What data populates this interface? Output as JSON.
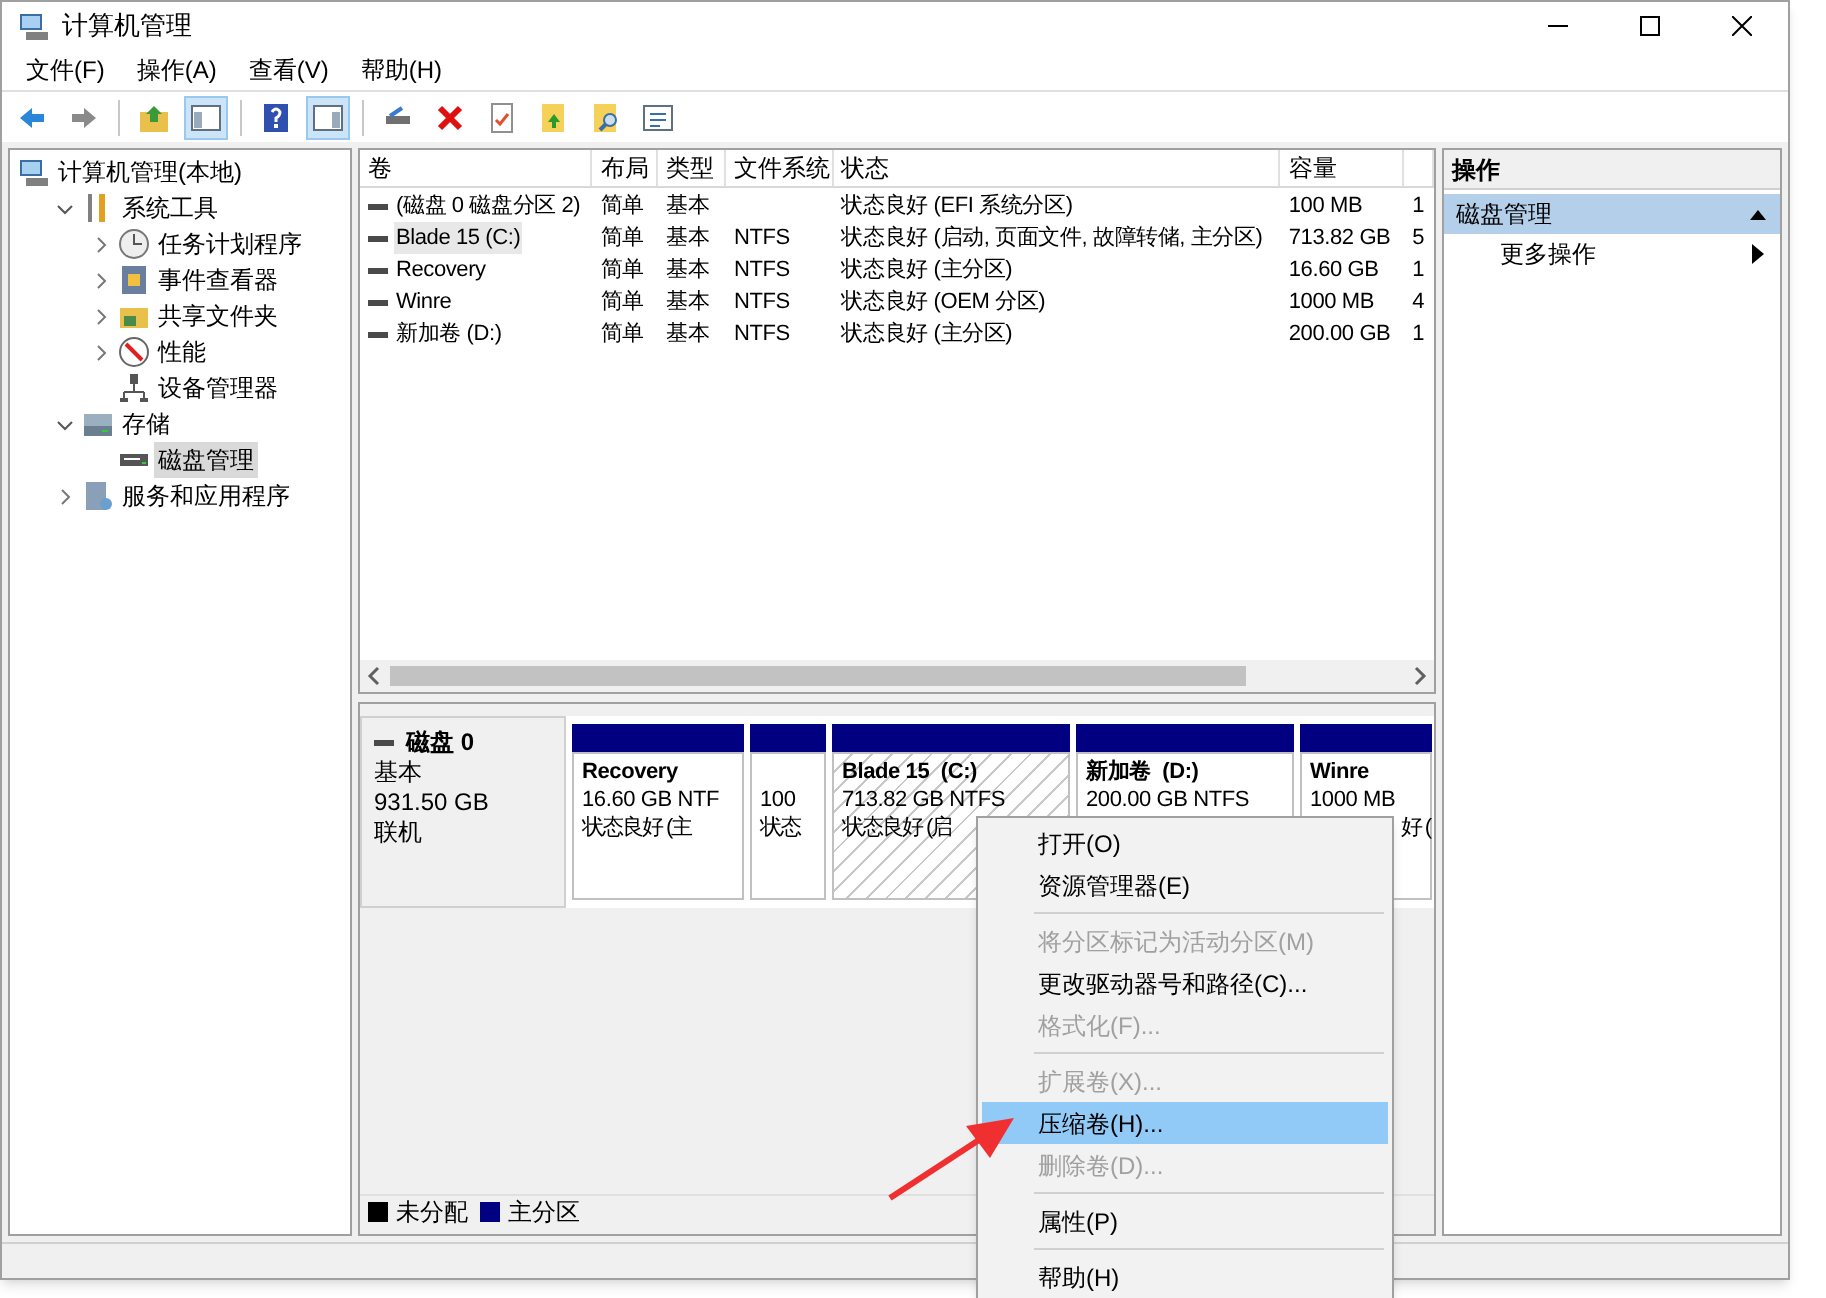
{
  "window": {
    "title": "计算机管理"
  },
  "menu": [
    "文件(F)",
    "操作(A)",
    "查看(V)",
    "帮助(H)"
  ],
  "tree": [
    {
      "label": "计算机管理(本地)",
      "selected": false,
      "children": [
        {
          "label": "系统工具",
          "expanded": true,
          "selected": false,
          "children": [
            {
              "label": "任务计划程序",
              "expanded": false,
              "selected": false
            },
            {
              "label": "事件查看器",
              "expanded": false,
              "selected": false
            },
            {
              "label": "共享文件夹",
              "expanded": false,
              "selected": false
            },
            {
              "label": "性能",
              "expanded": false,
              "selected": false
            },
            {
              "label": "设备管理器",
              "selected": false
            }
          ]
        },
        {
          "label": "存储",
          "expanded": true,
          "selected": false,
          "children": [
            {
              "label": "磁盘管理",
              "selected": true
            }
          ]
        },
        {
          "label": "服务和应用程序",
          "expanded": false,
          "selected": false
        }
      ]
    }
  ],
  "table": {
    "columns": [
      "卷",
      "布局",
      "类型",
      "文件系统",
      "状态",
      "容量"
    ],
    "rows": [
      {
        "volume": "(磁盘 0 磁盘分区 2)",
        "layout": "简单",
        "type": "基本",
        "status": "状态良好 (EFI 系统分区)",
        "capacity": "100 MB",
        "column_7": "1",
        "selected": false
      },
      {
        "volume": "Blade 15 (C:)",
        "layout": "简单",
        "type": "基本",
        "file_system": "NTFS",
        "status": "状态良好 (启动, 页面文件, 故障转储, 主分区)",
        "capacity": "713.82 GB",
        "column_7": "5",
        "selected": true
      },
      {
        "volume": "Recovery",
        "layout": "简单",
        "type": "基本",
        "file_system": "NTFS",
        "status": "状态良好 (主分区)",
        "capacity": "16.60 GB",
        "column_7": "1",
        "selected": false
      },
      {
        "volume": "Winre",
        "layout": "简单",
        "type": "基本",
        "file_system": "NTFS",
        "status": "状态良好 (OEM 分区)",
        "capacity": "1000 MB",
        "column_7": "4",
        "selected": false
      },
      {
        "volume": "新加卷 (D:)",
        "layout": "简单",
        "type": "基本",
        "file_system": "NTFS",
        "status": "状态良好 (主分区)",
        "capacity": "200.00 GB",
        "column_7": "1",
        "selected": false
      }
    ]
  },
  "disk": {
    "name": "磁盘 0",
    "type": "基本",
    "size": "931.50 GB",
    "status": "联机",
    "partitions": [
      {
        "name": "Recovery",
        "size": "16.60 GB NTF",
        "status": "状态良好 (主",
        "selected": false
      },
      {
        "size": "100",
        "status": "状态",
        "selected": false
      },
      {
        "name": "Blade 15  (C:)",
        "size": "713.82 GB NTFS",
        "status": "状态良好 (启",
        "selected": true
      },
      {
        "name": "新加卷  (D:)",
        "size": "200.00 GB NTFS",
        "selected": false
      },
      {
        "name": "Winre",
        "size": "1000 MB",
        "status": "好 (",
        "selected": false
      }
    ]
  },
  "legend": [
    {
      "label": "未分配",
      "color": "#000000"
    },
    {
      "label": "主分区",
      "color": "#000080"
    }
  ],
  "actions": {
    "title": "操作",
    "sections": [
      {
        "label": "磁盘管理",
        "expanded": true,
        "items": [
          "更多操作"
        ]
      }
    ]
  },
  "context_menu": [
    {
      "kind": "item",
      "label": "打开(O)",
      "disabled": false,
      "selected": false
    },
    {
      "kind": "item",
      "label": "资源管理器(E)",
      "disabled": false,
      "selected": false
    },
    {
      "kind": "separator"
    },
    {
      "kind": "item",
      "label": "将分区标记为活动分区(M)",
      "disabled": true,
      "selected": false
    },
    {
      "kind": "item",
      "label": "更改驱动器号和路径(C)...",
      "disabled": false,
      "selected": false
    },
    {
      "kind": "item",
      "label": "格式化(F)...",
      "disabled": true,
      "selected": false
    },
    {
      "kind": "separator"
    },
    {
      "kind": "item",
      "label": "扩展卷(X)...",
      "disabled": true,
      "selected": false
    },
    {
      "kind": "item",
      "label": "压缩卷(H)...",
      "disabled": false,
      "selected": true
    },
    {
      "kind": "item",
      "label": "删除卷(D)...",
      "disabled": true,
      "selected": false
    },
    {
      "kind": "separator"
    },
    {
      "kind": "item",
      "label": "属性(P)",
      "disabled": false,
      "selected": false
    },
    {
      "kind": "separator"
    },
    {
      "kind": "item",
      "label": "帮助(H)",
      "disabled": false,
      "selected": false
    }
  ]
}
